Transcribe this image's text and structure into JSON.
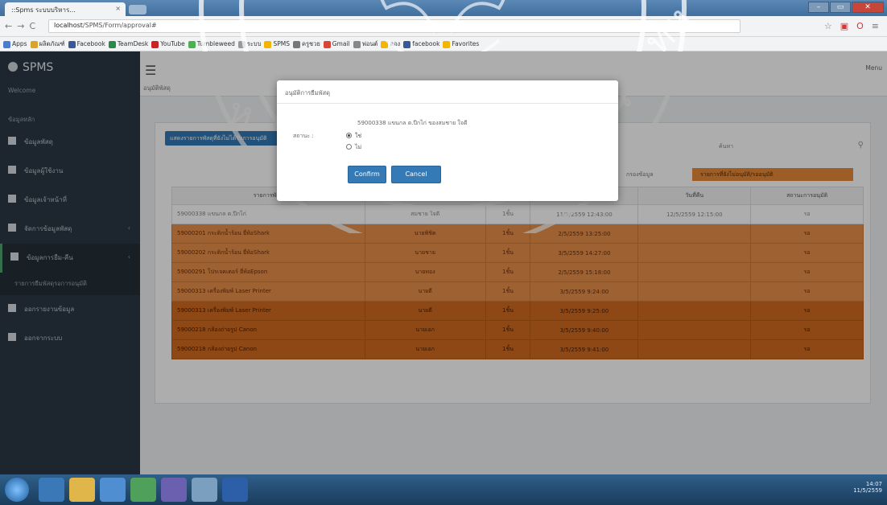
{
  "browser": {
    "tab_title": "::Spms ระบบบริหาร...",
    "url_host": "localhost",
    "url_path": "/SPMS/Form/approval#",
    "bookmarks": [
      "Apps",
      "ผลิตภัณฑ์",
      "Facebook",
      "TeamDesk",
      "YouTube",
      "Tumbleweed",
      "ระบบ",
      "SPMS",
      "ครูชวย",
      "Gmail",
      "ฟอนต์",
      "ลอง",
      "facebook",
      "Favorites"
    ],
    "window_buttons": [
      "–",
      "▭",
      "✕"
    ]
  },
  "app": {
    "brand": "SPMS",
    "welcome": "Welcome",
    "section_label": "ข้อมูลหลัก",
    "menu_label": "Menu",
    "breadcrumb": "อนุมัติพัสดุ",
    "sidebar": [
      {
        "label": "ข้อมูลพัสดุ",
        "icon": "box-icon",
        "chevron": false
      },
      {
        "label": "ข้อมูลผู้ใช้งาน",
        "icon": "user-icon",
        "chevron": false
      },
      {
        "label": "ข้อมูลเจ้าหน้าที่",
        "icon": "user-icon",
        "chevron": false
      },
      {
        "label": "จัดการข้อมูลพัสดุ",
        "icon": "pencil-icon",
        "chevron": true
      },
      {
        "label": "ข้อมูลการยืม-คืน",
        "icon": "folder-icon",
        "chevron": true
      },
      {
        "label": "ออกรายงานข้อมูล",
        "icon": "report-icon",
        "chevron": false
      },
      {
        "label": "ออกจากระบบ",
        "icon": "logout-icon",
        "chevron": false
      }
    ],
    "sidebar_sub": "รายการยืมพัสดุรอการอนุมัติ"
  },
  "panel": {
    "top_button": "แสดงรายการพัสดุที่ยังไม่ได้รับการอนุมัติ",
    "search_label": "ค้นหา",
    "filter_label": "กรองข้อมูล",
    "status_label": "รายการที่ยังไม่อนุมัติ/รออนุมัติ",
    "columns": [
      "รายการพัสดุ",
      "ผู้ยืม",
      "จำนวน",
      "วันที่ยืม",
      "วันที่คืน",
      "สถานะการอนุมัติ"
    ],
    "rows": [
      {
        "item": "59000338 แขนกล ต.ปีกไก่",
        "user": "สมชาย ใจดี",
        "qty": "1ชิ้น",
        "borrow": "11/5/2559 12:43:00",
        "return": "12/5/2559 12:15:00",
        "status": "รอ",
        "tone": "plain"
      },
      {
        "item": "59000201 กระติกน้ำร้อน ยี่ห้อShark",
        "user": "นายพิชิต",
        "qty": "1ชิ้น",
        "borrow": "2/5/2559 13:25:00",
        "return": "",
        "status": "รอ",
        "tone": "light"
      },
      {
        "item": "59000202 กระติกน้ำร้อน ยี่ห้อShark",
        "user": "นายชาย",
        "qty": "1ชิ้น",
        "borrow": "3/5/2559 14:27:00",
        "return": "",
        "status": "รอ",
        "tone": "light"
      },
      {
        "item": "59000291 โปรเจคเตอร์ ยี่ห้อEpson",
        "user": "นายทอง",
        "qty": "1ชิ้น",
        "borrow": "2/5/2559 15:18:00",
        "return": "",
        "status": "รอ",
        "tone": "light"
      },
      {
        "item": "59000313 เครื่องพิมพ์ Laser Printer",
        "user": "นายดี",
        "qty": "1ชิ้น",
        "borrow": "3/5/2559 9:24:00",
        "return": "",
        "status": "รอ",
        "tone": "light"
      },
      {
        "item": "59000313 เครื่องพิมพ์ Laser Printer",
        "user": "นายดี",
        "qty": "1ชิ้น",
        "borrow": "3/5/2559 9:25:00",
        "return": "",
        "status": "รอ",
        "tone": "dark"
      },
      {
        "item": "59000218 กล้องถ่ายรูป Canon",
        "user": "นายเอก",
        "qty": "1ชิ้น",
        "borrow": "3/5/2559 9:40:00",
        "return": "",
        "status": "รอ",
        "tone": "dark"
      },
      {
        "item": "59000218 กล้องถ่ายรูป Canon",
        "user": "นายเอก",
        "qty": "1ชิ้น",
        "borrow": "3/5/2559 9:41:00",
        "return": "",
        "status": "รอ",
        "tone": "dark"
      }
    ]
  },
  "modal": {
    "title": "อนุมัติการยืมพัสดุ",
    "message": "59000338 แขนกล ต.ปีกไก่ ของสมชาย ใจดี",
    "field_label": "สถานะ :",
    "options": [
      {
        "label": "ใช่",
        "selected": true
      },
      {
        "label": "ไม่",
        "selected": false
      }
    ],
    "confirm_label": "Confirm",
    "cancel_label": "Cancel"
  },
  "taskbar": {
    "time": "14:07",
    "date": "11/5/2559"
  },
  "colors": {
    "accent": "#337ab7",
    "pending_light": "#e8904a",
    "pending_dark": "#d06a1f",
    "sidebar": "#2b3944"
  }
}
